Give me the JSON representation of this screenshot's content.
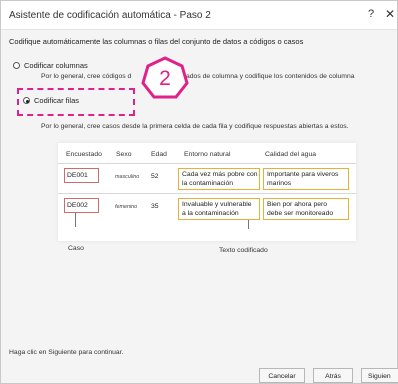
{
  "window": {
    "title": "Asistente de codificación automática - Paso 2",
    "help_glyph": "?",
    "close_glyph": "✕"
  },
  "instruction": "Codifique automáticamente las columnas o filas del conjunto de datos a códigos o casos",
  "options": {
    "columns": {
      "label": "Codificar columnas",
      "checked": false,
      "desc_left": "Por lo general, cree códigos d",
      "desc_right": "ados de columna y codifique los contenidos de columna"
    },
    "rows": {
      "label": "Codificar filas",
      "checked": true,
      "desc": "Por lo general, cree casos desde la primera celda de cada fila y codifique respuestas abiertas a estos."
    }
  },
  "callout_number": "2",
  "table": {
    "headers": [
      "Encuestado",
      "Sexo",
      "Edad",
      "Entorno natural",
      "Calidad del agua"
    ],
    "rows": [
      {
        "id": "DE001",
        "sex": "masculino",
        "age": "52",
        "env_line1": "Cada vez más pobre con",
        "env_line2": "la contaminación",
        "water_line1": "Importante para viveros",
        "water_line2": "marinos"
      },
      {
        "id": "DE002",
        "sex": "femenino",
        "age": "35",
        "env_line1": "Invaluable y  vulnerable",
        "env_line2": "a la contaminación",
        "water_line1": "Bien por ahora  pero",
        "water_line2": "debe ser monitoreado"
      }
    ],
    "label_case": "Caso",
    "label_coded": "Texto codificado"
  },
  "footer_text": "Haga clic en Siguiente para continuar.",
  "buttons": {
    "cancel": "Cancelar",
    "back": "Atrás",
    "next": "Siguien"
  },
  "colors": {
    "accent": "#e0218a",
    "case_border": "#d36a6a",
    "coded_border": "#e3b237"
  }
}
